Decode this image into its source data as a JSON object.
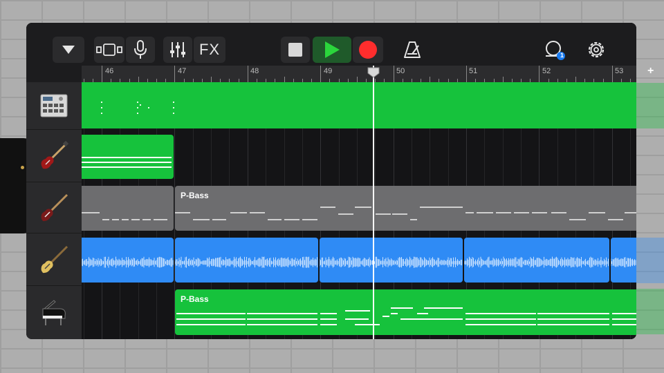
{
  "toolbar": {
    "fx_label": "FX",
    "loops_badge": "1"
  },
  "ruler": {
    "bars": [
      "46",
      "47",
      "48",
      "49",
      "50",
      "51",
      "52",
      "53"
    ]
  },
  "tracks": [
    {
      "instrument_icon": "drum-machine-icon"
    },
    {
      "instrument_icon": "electric-guitar-icon"
    },
    {
      "instrument_icon": "bass-guitar-icon"
    },
    {
      "instrument_icon": "acoustic-bass-icon"
    },
    {
      "instrument_icon": "grand-piano-icon"
    }
  ],
  "regions": {
    "bass_region_name": "P-Bass",
    "piano_region_name": "P-Bass"
  },
  "colors": {
    "green": "#16c23c",
    "blue": "#2f8bf5",
    "gray": "#6d6d6f",
    "play": "#2bd63c",
    "record": "#ff2d2d",
    "badge": "#1a7cf2"
  }
}
